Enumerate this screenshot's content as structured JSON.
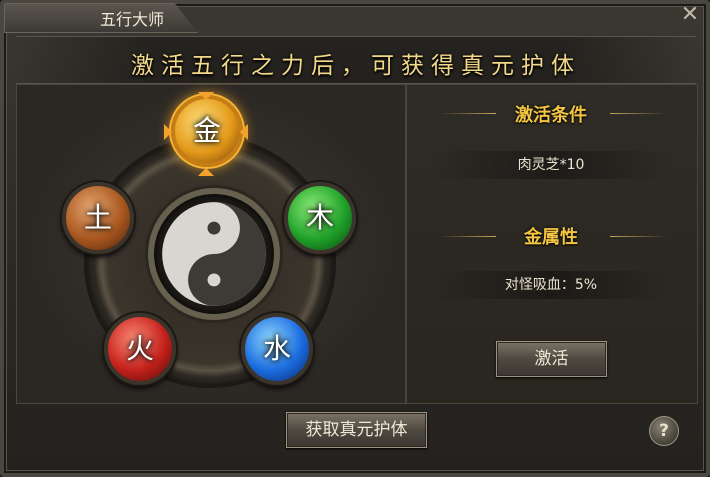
{
  "window": {
    "title": "五行大师",
    "close_label": "✕"
  },
  "banner": {
    "text": "激活五行之力后，可获得真元护体"
  },
  "elements": {
    "jin": "金",
    "tu": "土",
    "mu": "木",
    "huo": "火",
    "shui": "水"
  },
  "right_panel": {
    "condition_title": "激活条件",
    "condition_value": "肉灵芝*10",
    "attribute_title": "金属性",
    "attribute_value": "对怪吸血：5%"
  },
  "buttons": {
    "activate": "激活",
    "gain": "获取真元护体",
    "help": "?"
  },
  "colors": {
    "title_gold": "#f4c542",
    "banner_gold": "#f3d98a",
    "jin": "#e39a1a",
    "tu": "#a9571f",
    "mu": "#1fa129",
    "huo": "#c4211b",
    "shui": "#1b6ce0"
  }
}
